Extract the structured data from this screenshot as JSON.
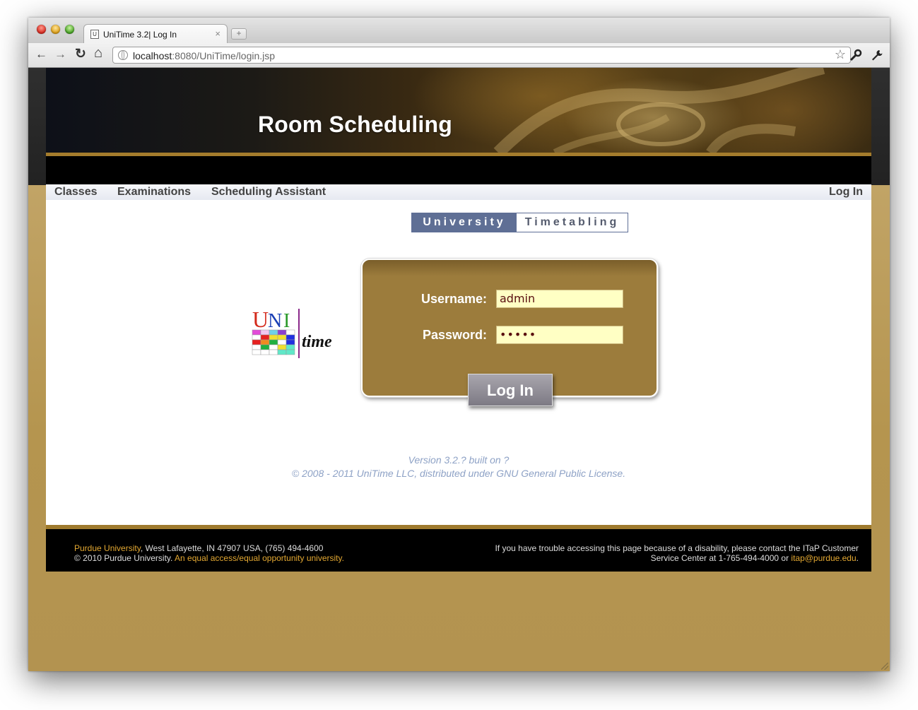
{
  "browser": {
    "tab_title": "UniTime 3.2| Log In",
    "tab_close": "×",
    "new_tab": "+",
    "url_host": "localhost",
    "url_rest": ":8080/UniTime/login.jsp",
    "back": "←",
    "forward": "→",
    "reload": "↻",
    "home": "⌂",
    "bookmark_star": "☆"
  },
  "header": {
    "title": "Room Scheduling"
  },
  "menu": {
    "items": [
      "Classes",
      "Examinations",
      "Scheduling Assistant"
    ],
    "login_link": "Log In"
  },
  "brand": {
    "left": "University",
    "right": "Timetabling",
    "logo_uni": "UNI",
    "logo_time": "time"
  },
  "login": {
    "username_label": "Username:",
    "username_value": "admin",
    "password_label": "Password:",
    "password_value": "•••••",
    "button": "Log In"
  },
  "version": {
    "line1": "Version 3.2.? built on ?",
    "line2": "© 2008 - 2011 UniTime LLC, distributed under GNU General Public License."
  },
  "footer": {
    "university": "Purdue University",
    "address": ", West Lafayette, IN 47907 USA, (765) 494-4600",
    "copyright": "© 2010 Purdue University. ",
    "equal_access": "An equal access/equal opportunity university.",
    "trouble_line1": "If you have trouble accessing this page because of a disability, please contact the ITaP Customer",
    "trouble_line2": "Service Center at 1-765-494-4000 or ",
    "email": "itap@purdue.edu",
    "period": "."
  },
  "colors": {
    "gold": "#b5954f",
    "banner_accent": "#a47c2c",
    "login_panel": "#9c7c3c",
    "input_bg": "#ffffc4",
    "footer_link": "#e3a832",
    "version_text": "#8ea2c6"
  },
  "icons": [
    "back-icon",
    "forward-icon",
    "reload-icon",
    "home-icon",
    "globe-icon",
    "star-icon",
    "key-icon",
    "wrench-icon"
  ]
}
